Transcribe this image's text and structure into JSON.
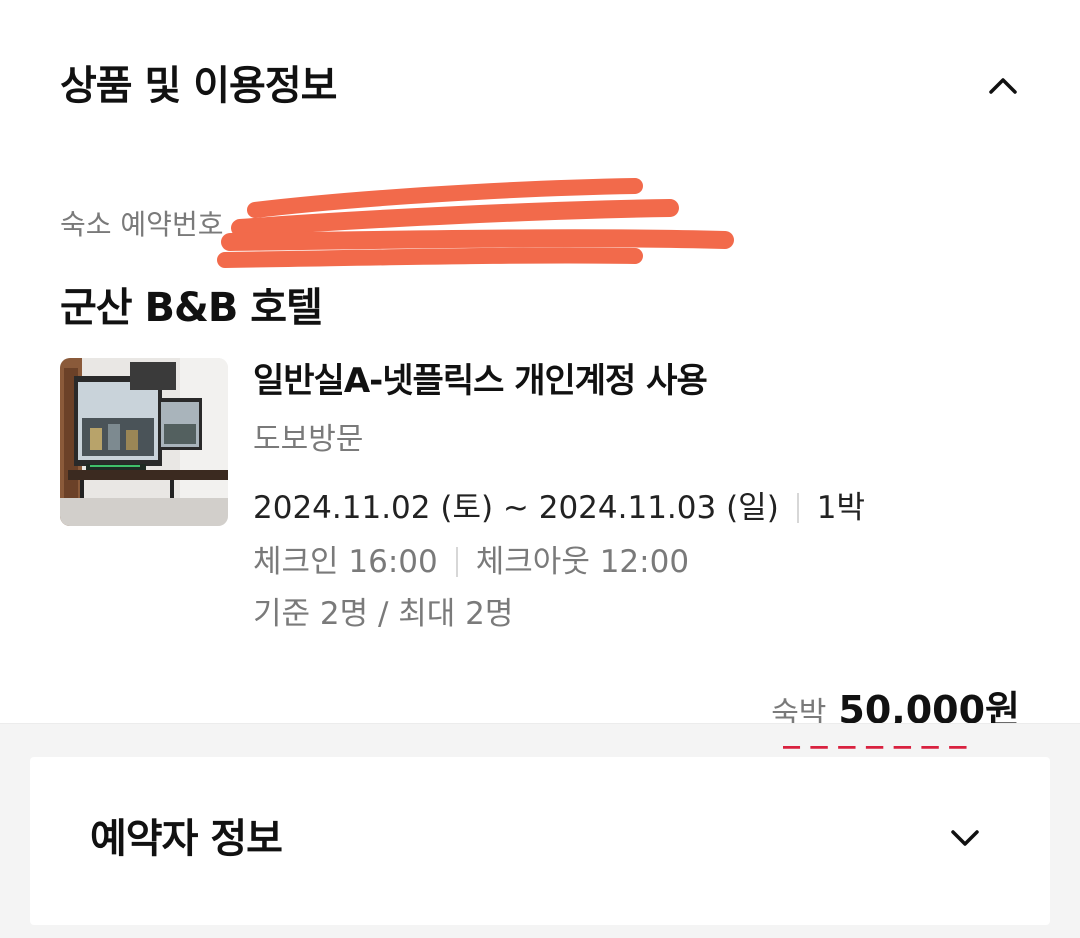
{
  "product_section": {
    "title": "상품 및 이용정보",
    "toggle_icon": "chevron-up-icon"
  },
  "reservation": {
    "number_label": "숙소 예약번호"
  },
  "hotel": {
    "name": "군산 B&B 호텔"
  },
  "room": {
    "name": "일반실A-넷플릭스 개인계정 사용",
    "visit_type": "도보방문",
    "date_range": "2024.11.02 (토) ~ 2024.11.03 (일)",
    "nights": "1박",
    "checkin": "체크인 16:00",
    "checkout": "체크아웃 12:00",
    "occupancy": "기준 2명 / 최대 2명"
  },
  "price": {
    "label": "숙박",
    "amount": "50,000원"
  },
  "booker_section": {
    "title": "예약자 정보",
    "toggle_icon": "chevron-down-icon"
  },
  "colors": {
    "redaction": "#f26a4b",
    "accent_red": "#d9213f",
    "muted_text": "#7a7a7a"
  }
}
